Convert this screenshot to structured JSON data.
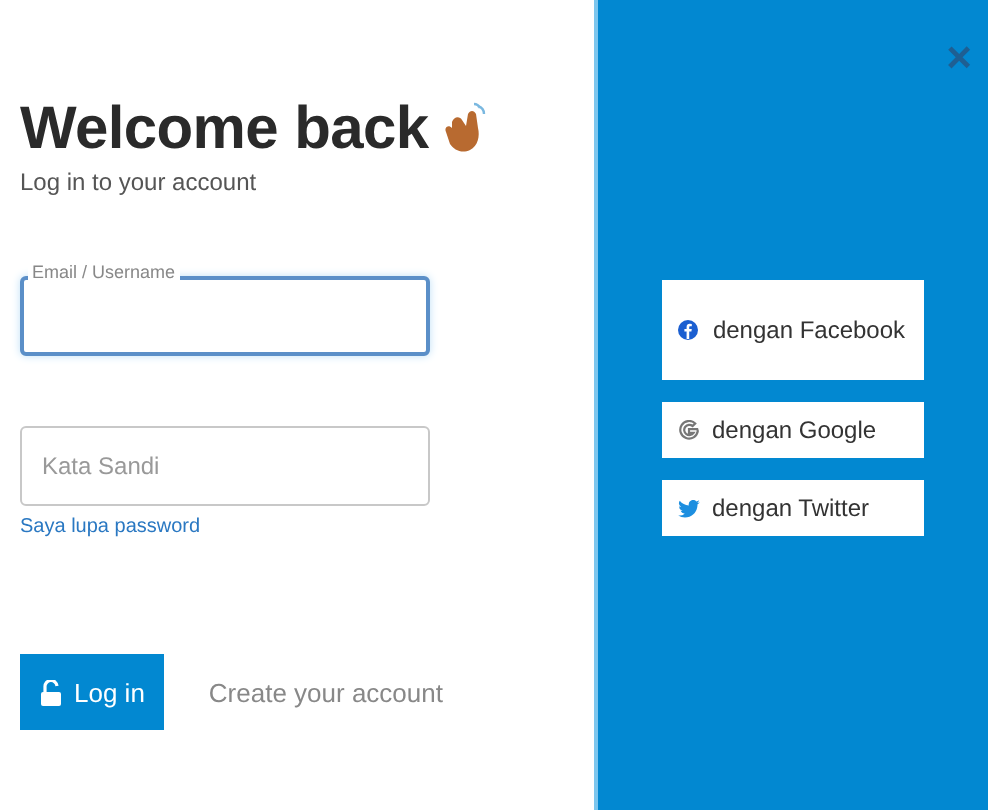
{
  "close_button": {
    "label": "×"
  },
  "heading": {
    "title": "Welcome back",
    "subtitle": "Log in to your account"
  },
  "fields": [
    {
      "kind": "email",
      "label": "Email / Username",
      "focused": true
    },
    {
      "kind": "password",
      "placeholder": "Kata Sandi",
      "focused": false
    }
  ],
  "forgot_link": "Saya lupa password",
  "login_button": "Log in",
  "create_account": "Create your account",
  "social_buttons": [
    {
      "kind": "facebook",
      "label": "dengan Facebook"
    },
    {
      "kind": "google",
      "label": "dengan Google"
    },
    {
      "kind": "twitter",
      "label": "dengan Twitter"
    }
  ]
}
